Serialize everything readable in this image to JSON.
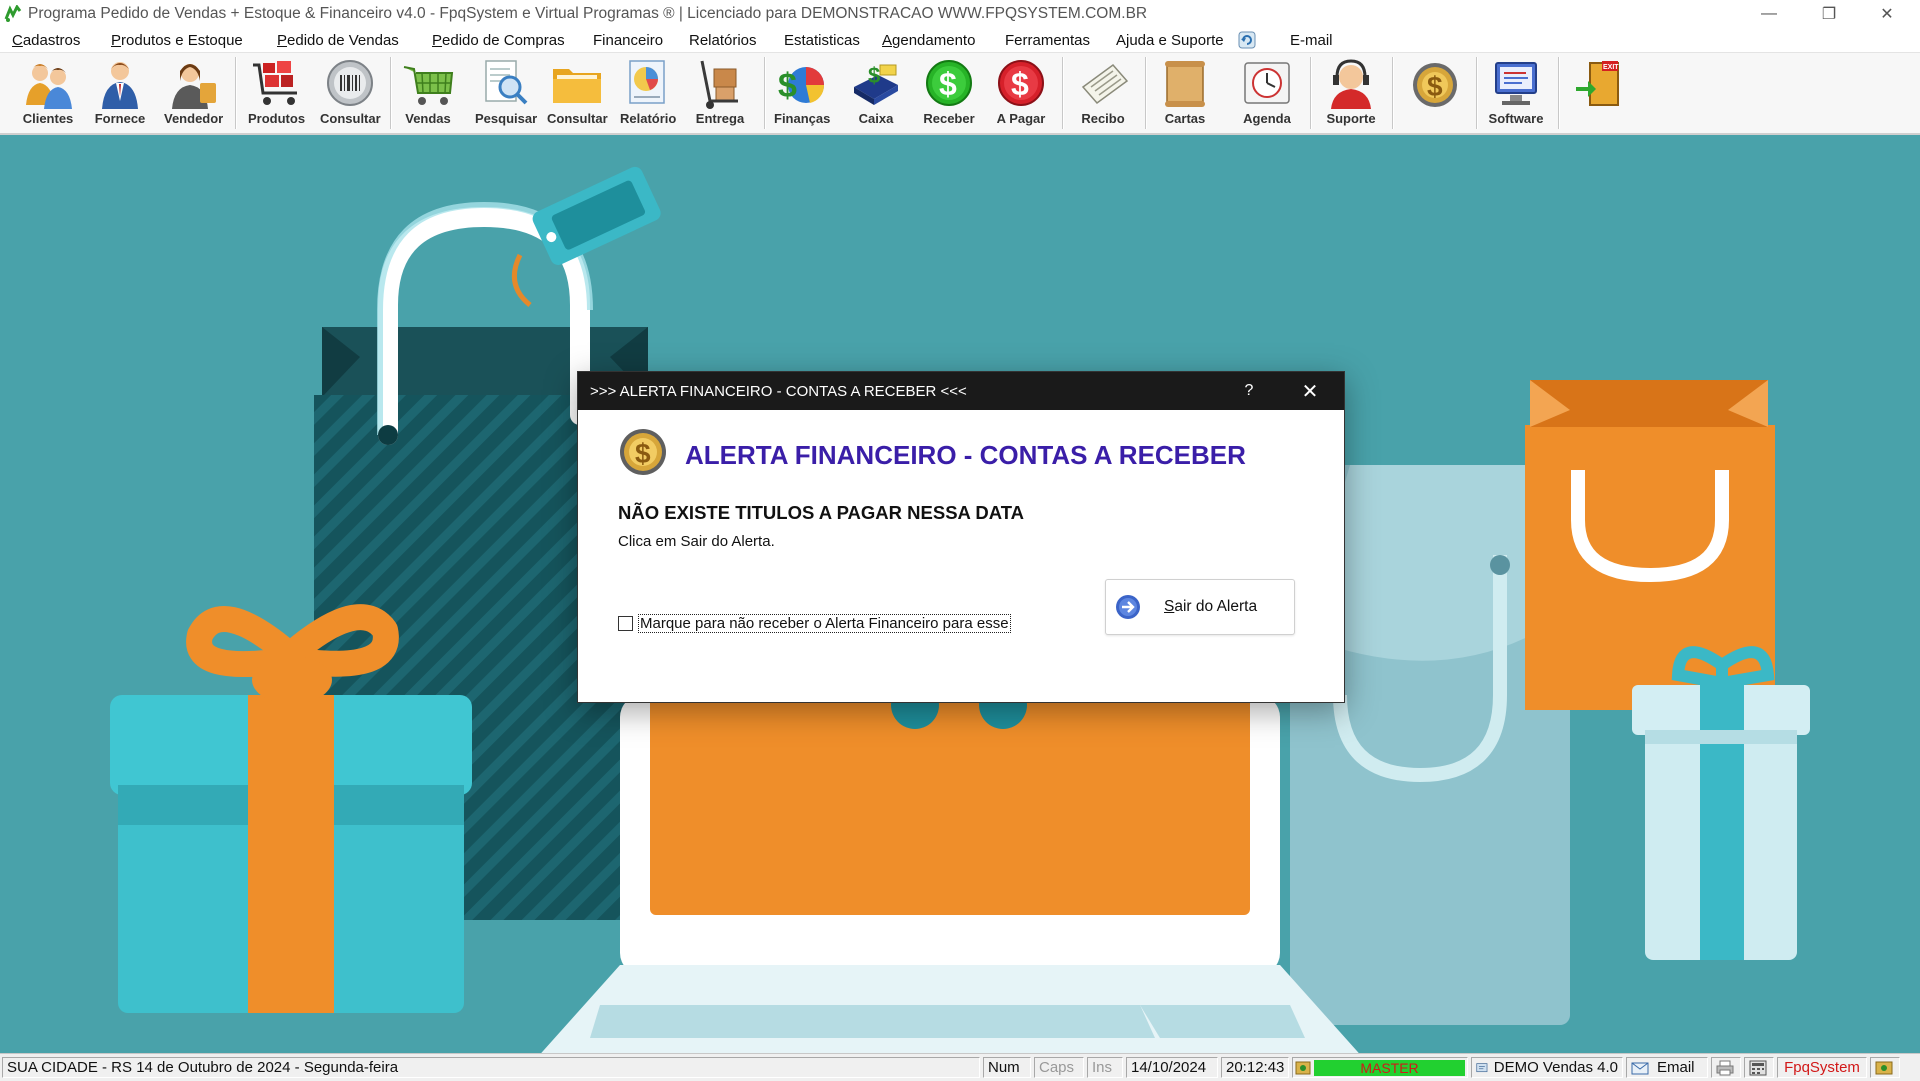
{
  "window": {
    "title": "Programa Pedido de Vendas + Estoque & Financeiro v4.0 - FpqSystem e Virtual Programas ® | Licenciado para  DEMONSTRACAO WWW.FPQSYSTEM.COM.BR",
    "minimize_glyph": "—",
    "restore_glyph": "❐",
    "close_glyph": "✕"
  },
  "menu": [
    {
      "u": "C",
      "rest": "adastros"
    },
    {
      "u": "P",
      "rest": "rodutos e Estoque"
    },
    {
      "u": "P",
      "rest": "edido de Vendas"
    },
    {
      "u": "P",
      "rest": "edido de Compras"
    },
    {
      "u": "",
      "rest": "Financeiro"
    },
    {
      "u": "",
      "rest": "Relatórios"
    },
    {
      "u": "",
      "rest": "Estatisticas"
    },
    {
      "u": "A",
      "rest": "gendamento"
    },
    {
      "u": "",
      "rest": "Ferramentas"
    },
    {
      "u": "",
      "rest": "Ajuda e Suporte"
    },
    {
      "u": "",
      "rest": "E-mail"
    }
  ],
  "toolbar": [
    {
      "label": "Clientes",
      "icon": "people-icon"
    },
    {
      "label": "Fornece",
      "icon": "supplier-icon"
    },
    {
      "label": "Vendedor",
      "icon": "salesperson-icon"
    },
    {
      "label": "Produtos",
      "icon": "cart-boxes-icon"
    },
    {
      "label": "Consultar",
      "icon": "barcode-icon"
    },
    {
      "label": "Vendas",
      "icon": "shopping-cart-icon"
    },
    {
      "label": "Pesquisar",
      "icon": "magnifier-document-icon"
    },
    {
      "label": "Consultar",
      "icon": "folder-icon"
    },
    {
      "label": "Relatório",
      "icon": "report-icon"
    },
    {
      "label": "Entrega",
      "icon": "hand-truck-icon"
    },
    {
      "label": "Finanças",
      "icon": "finance-icon"
    },
    {
      "label": "Caixa",
      "icon": "cash-register-icon"
    },
    {
      "label": "Receber",
      "icon": "green-dollar-icon"
    },
    {
      "label": "A Pagar",
      "icon": "red-dollar-icon"
    },
    {
      "label": "Recibo",
      "icon": "receipt-icon"
    },
    {
      "label": "Cartas",
      "icon": "scroll-icon"
    },
    {
      "label": "Agenda",
      "icon": "agenda-icon"
    },
    {
      "label": "Suporte",
      "icon": "support-icon"
    },
    {
      "label": "",
      "icon": "gold-coin-icon"
    },
    {
      "label": "Software",
      "icon": "software-icon"
    },
    {
      "label": "",
      "icon": "exit-door-icon"
    }
  ],
  "dialog": {
    "title": ">>> ALERTA FINANCEIRO - CONTAS A RECEBER <<<",
    "help_glyph": "?",
    "close_glyph": "✕",
    "heading": "ALERTA FINANCEIRO - CONTAS A RECEBER",
    "message": "NÃO EXISTE TITULOS A PAGAR NESSA DATA",
    "submessage": "Clica em Sair do Alerta.",
    "checkbox_label": "Marque para não receber o Alerta Financeiro para esse",
    "checkbox_checked": false,
    "button_underline": "S",
    "button_rest": "air do Alerta"
  },
  "status": {
    "city_date": "SUA CIDADE - RS 14 de Outubro de 2024 - Segunda-feira",
    "num": "Num",
    "caps": "Caps",
    "ins": "Ins",
    "date": "14/10/2024",
    "time": "20:12:43",
    "user": "MASTER",
    "version": "DEMO Vendas 4.0",
    "email": "Email",
    "brand": "FpqSystem"
  },
  "colors": {
    "desktop": "#49a2aa",
    "heading": "#3a1ea8",
    "master_bar": "#22d030",
    "master_text": "#d21818",
    "brand_text": "#d21818"
  }
}
